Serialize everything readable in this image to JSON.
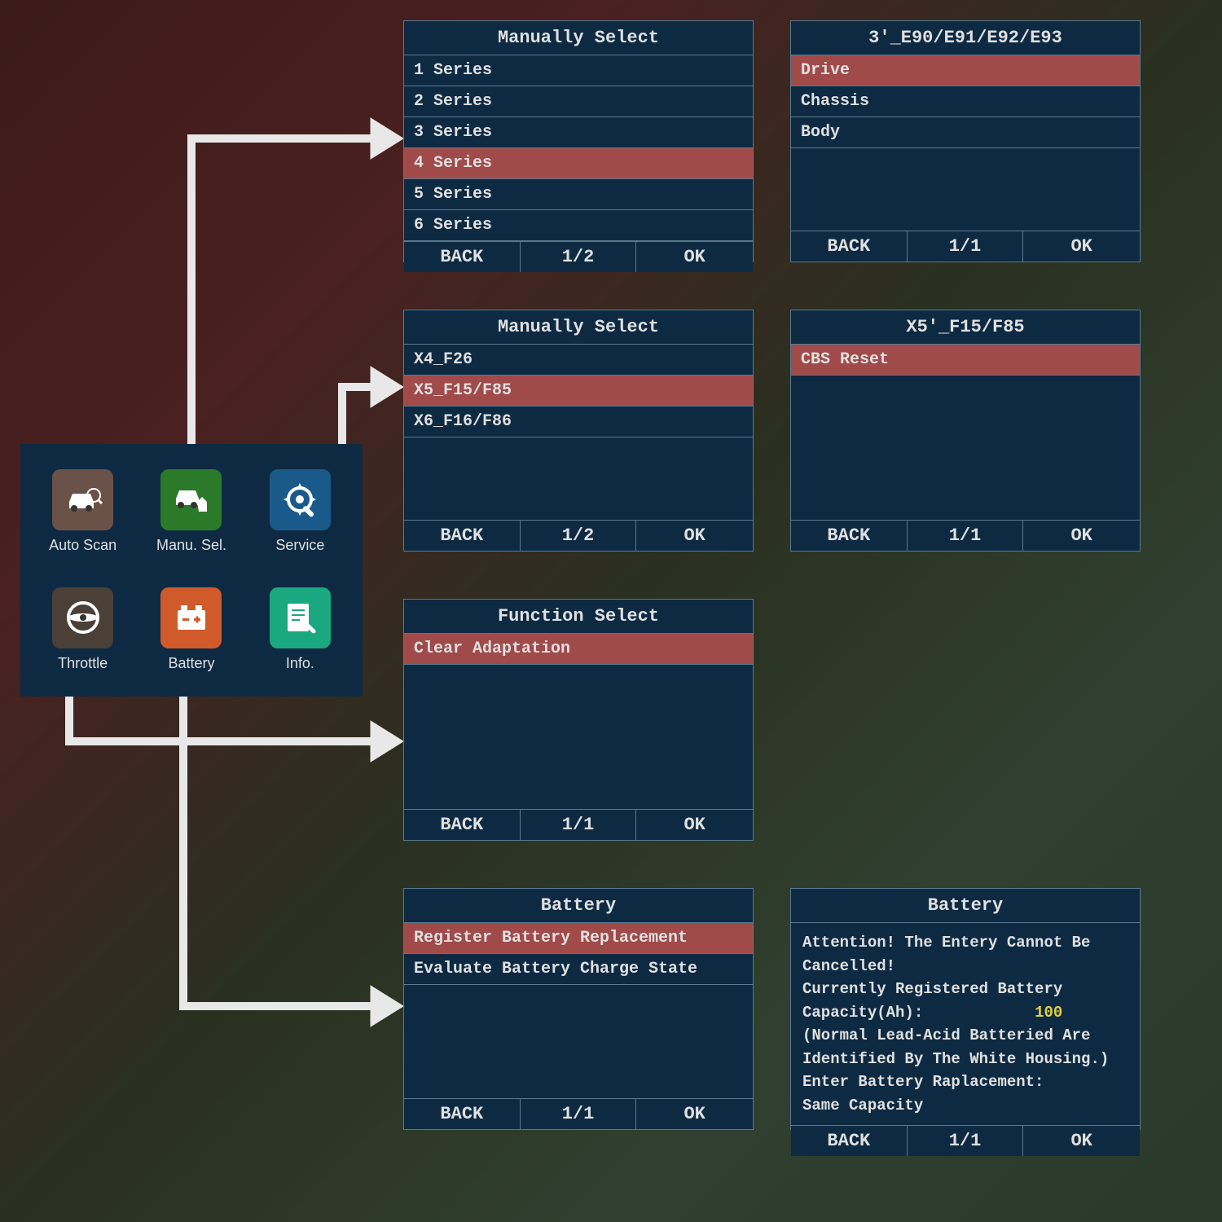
{
  "menu": {
    "items": [
      {
        "label": "Auto Scan"
      },
      {
        "label": "Manu. Sel."
      },
      {
        "label": "Service"
      },
      {
        "label": "Throttle"
      },
      {
        "label": "Battery"
      },
      {
        "label": "Info."
      }
    ]
  },
  "screens": {
    "s1": {
      "title": "Manually Select",
      "rows": [
        "1 Series",
        "2 Series",
        "3 Series",
        "4 Series",
        "5 Series",
        "6 Series"
      ],
      "selected": 3,
      "footer": {
        "back": "BACK",
        "page": "1/2",
        "ok": "OK"
      }
    },
    "s2": {
      "title": "3'_E90/E91/E92/E93",
      "rows": [
        "Drive",
        "Chassis",
        "Body"
      ],
      "selected": 0,
      "footer": {
        "back": "BACK",
        "page": "1/1",
        "ok": "OK"
      }
    },
    "s3": {
      "title": "Manually Select",
      "rows": [
        "X4_F26",
        "X5_F15/F85",
        "X6_F16/F86"
      ],
      "selected": 1,
      "footer": {
        "back": "BACK",
        "page": "1/2",
        "ok": "OK"
      }
    },
    "s4": {
      "title": "X5'_F15/F85",
      "rows": [
        "CBS Reset"
      ],
      "selected": 0,
      "footer": {
        "back": "BACK",
        "page": "1/1",
        "ok": "OK"
      }
    },
    "s5": {
      "title": "Function Select",
      "rows": [
        "Clear Adaptation"
      ],
      "selected": 0,
      "footer": {
        "back": "BACK",
        "page": "1/1",
        "ok": "OK"
      }
    },
    "s6": {
      "title": "Battery",
      "rows": [
        "Register Battery Replacement",
        "Evaluate Battery Charge State"
      ],
      "selected": 0,
      "footer": {
        "back": "BACK",
        "page": "1/1",
        "ok": "OK"
      }
    },
    "s7": {
      "title": "Battery",
      "text_lines": [
        "Attention! The Entery Cannot Be Cancelled!",
        "Currently Registered Battery Capacity(Ah):",
        "(Normal Lead-Acid Batteried Are Identified By The White Housing.)",
        "Enter Battery Raplacement:",
        "Same Capacity"
      ],
      "value": "100",
      "footer": {
        "back": "BACK",
        "page": "1/1",
        "ok": "OK"
      }
    }
  }
}
